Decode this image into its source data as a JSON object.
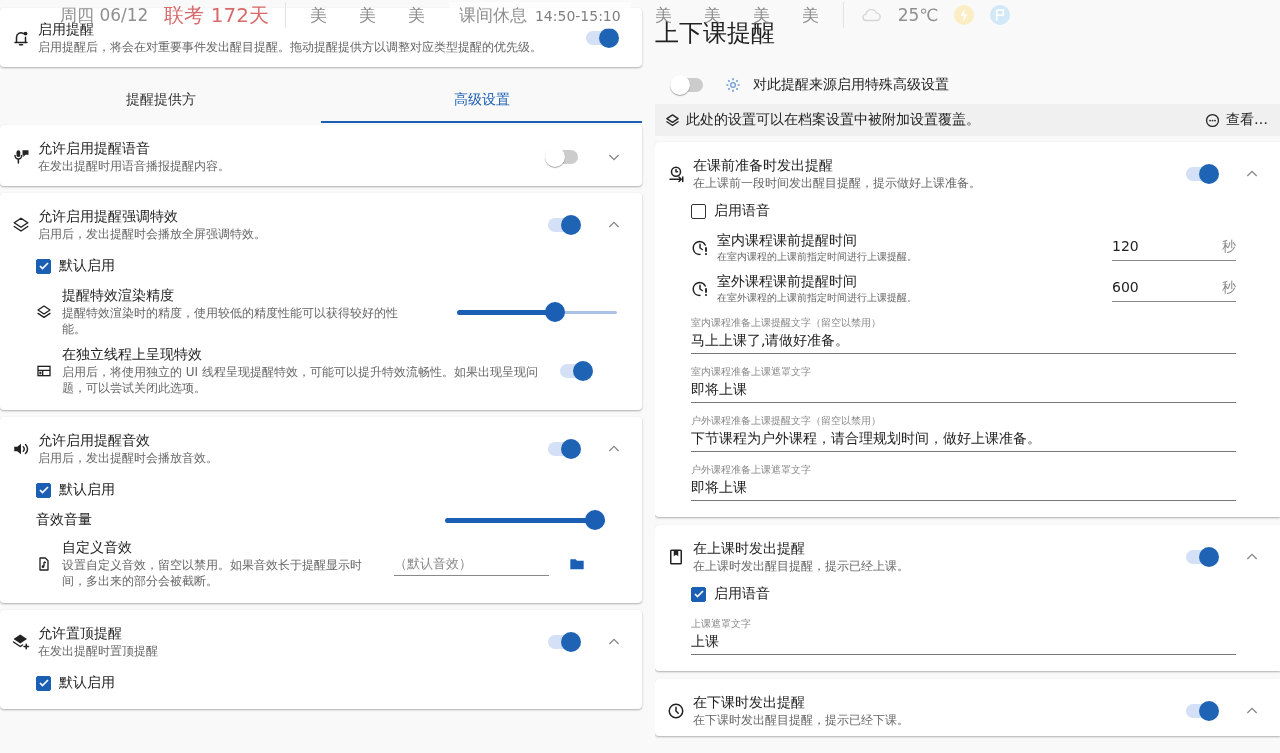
{
  "overlay": {
    "date": "周四 06/12",
    "countdown": "联考 172天",
    "lessons_before": [
      "美",
      "美",
      "美"
    ],
    "current": "课间休息",
    "time": "14:50-15:10",
    "lessons_after": [
      "美",
      "美",
      "美",
      "美"
    ],
    "weather": "25℃"
  },
  "left": {
    "master": {
      "title": "启用提醒",
      "desc": "启用提醒后，将会在对重要事件发出醒目提醒。拖动提醒提供方以调整对应类型提醒的优先级。",
      "on": true
    },
    "tabs": [
      {
        "label": "提醒提供方",
        "selected": false
      },
      {
        "label": "高级设置",
        "selected": true
      }
    ],
    "cards": [
      {
        "title": "允许启用提醒语音",
        "desc": "在发出提醒时用语音播报提醒内容。",
        "on": false,
        "expanded": false
      },
      {
        "title": "允许启用提醒强调特效",
        "desc": "启用后，发出提醒时会播放全屏强调特效。",
        "on": true,
        "expanded": true,
        "items": [
          {
            "kind": "checkbox",
            "label": "默认启用",
            "checked": true
          },
          {
            "kind": "slider",
            "title": "提醒特效渲染精度",
            "desc": "提醒特效渲染时的精度，使用较低的精度性能可以获得较好的性能。",
            "level": 0.63
          },
          {
            "kind": "toggle",
            "title": "在独立线程上呈现特效",
            "desc": "启用后，将使用独立的 UI 线程呈现提醒特效，可能可以提升特效流畅性。如果出现呈现问题，可以尝试关闭此选项。",
            "on": true
          }
        ]
      },
      {
        "title": "允许启用提醒音效",
        "desc": "启用后，发出提醒时会播放音效。",
        "on": true,
        "expanded": true,
        "items": [
          {
            "kind": "checkbox",
            "label": "默认启用",
            "checked": true
          },
          {
            "kind": "slider",
            "title": "音效音量",
            "level": 1
          },
          {
            "kind": "file",
            "title": "自定义音效",
            "desc": "设置自定义音效，留空以禁用。如果音效长于提醒显示时间，多出来的部分会被截断。",
            "placeholder": "（默认音效）"
          }
        ]
      },
      {
        "title": "允许置顶提醒",
        "desc": "在发出提醒时置顶提醒",
        "on": true,
        "expanded": true,
        "items": [
          {
            "kind": "checkbox",
            "label": "默认启用",
            "checked": true
          }
        ]
      }
    ]
  },
  "right": {
    "title": "上下课提醒",
    "special": {
      "label": "对此提醒来源启用特殊高级设置",
      "on": false
    },
    "notice": {
      "text": "此处的设置可以在档案设置中被附加设置覆盖。",
      "action": "查看…"
    },
    "cards": [
      {
        "title": "在课前准备时发出提醒",
        "desc": "在上课前一段时间发出醒目提醒，提示做好上课准备。",
        "on": true,
        "expanded": true,
        "items": [
          {
            "kind": "checkbox",
            "label": "启用语音",
            "checked": false
          },
          {
            "kind": "number",
            "title": "室内课程课前提醒时间",
            "desc": "在室内课程的上课前指定时间进行上课提醒。",
            "value": "120",
            "unit": "秒"
          },
          {
            "kind": "number",
            "title": "室外课程课前提醒时间",
            "desc": "在室外课程的上课前指定时间进行上课提醒。",
            "value": "600",
            "unit": "秒"
          },
          {
            "kind": "text",
            "label": "室内课程准备上课提醒文字（留空以禁用）",
            "value": "马上上课了,请做好准备。"
          },
          {
            "kind": "text",
            "label": "室内课程准备上课遮罩文字",
            "value": "即将上课"
          },
          {
            "kind": "text",
            "label": "户外课程准备上课提醒文字（留空以禁用）",
            "value": "下节课程为户外课程，请合理规划时间，做好上课准备。"
          },
          {
            "kind": "text",
            "label": "户外课程准备上课遮罩文字",
            "value": "即将上课"
          }
        ]
      },
      {
        "title": "在上课时发出提醒",
        "desc": "在上课时发出醒目提醒，提示已经上课。",
        "on": true,
        "expanded": true,
        "items": [
          {
            "kind": "checkbox",
            "label": "启用语音",
            "checked": true
          },
          {
            "kind": "text",
            "label": "上课遮罩文字",
            "value": "上课"
          }
        ]
      },
      {
        "title": "在下课时发出提醒",
        "desc": "在下课时发出醒目提醒，提示已经下课。",
        "on": true,
        "expanded": true
      }
    ]
  }
}
